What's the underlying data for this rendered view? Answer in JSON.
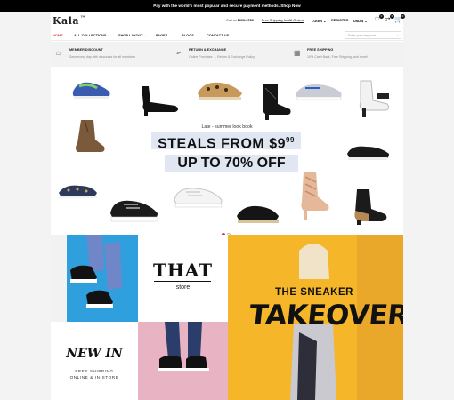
{
  "topbar": {
    "text": "Pay with the world's most popular and secure payment methods. Shop Now"
  },
  "header": {
    "logo": "Kala",
    "logo_mark": "™",
    "call_label": "Call us",
    "call_number": "1900-6789",
    "free_shipping": "Free Shipping for All Orders",
    "login": "LOGIN",
    "register": "REGISTER",
    "currency": "USD $",
    "wishlist_count": "0",
    "compare_count": "0",
    "cart_count": "0"
  },
  "nav": {
    "home": "HOME",
    "all_collections": "ALL COLLECTIONS",
    "shop_layout": "SHOP LAYOUT",
    "pages": "PAGES",
    "blogs": "BLOGS",
    "contact_us": "CONTACT US",
    "search_placeholder": "Enter your keyword..."
  },
  "services": [
    {
      "title": "MEMBER DISCOUNT",
      "desc": "Save every day with discounts for all members",
      "icon": "tag-icon"
    },
    {
      "title": "RETURN & EXCHANGE",
      "desc": "Online Purchase → Return & Exchange Policy",
      "icon": "send-icon"
    },
    {
      "title": "FREE SHIPPING",
      "desc": "10% Cash Back, Free Shipping, and more!",
      "icon": "map-icon"
    }
  ],
  "hero": {
    "lookbook": "Late - summer look book",
    "steals": "STEALS FROM $9",
    "steals_cents": "99",
    "upto": "UP TO 70% OFF"
  },
  "banners": {
    "that_title": "THAT",
    "that_sub": "store",
    "sneaker_line1": "THE SNEAKER",
    "sneaker_line2": "TAKEOVER",
    "newin_title": "NEW IN",
    "newin_line1": "FREE SHIPPING",
    "newin_line2": "ONLINE & IN-STORE"
  },
  "colors": {
    "accent": "#d43a3a",
    "hero_highlight": "#e1e7f2",
    "blue_banner": "#2f9fdd",
    "yellow_banner": "#f5b62a",
    "pink_banner": "#e8b4c3"
  }
}
